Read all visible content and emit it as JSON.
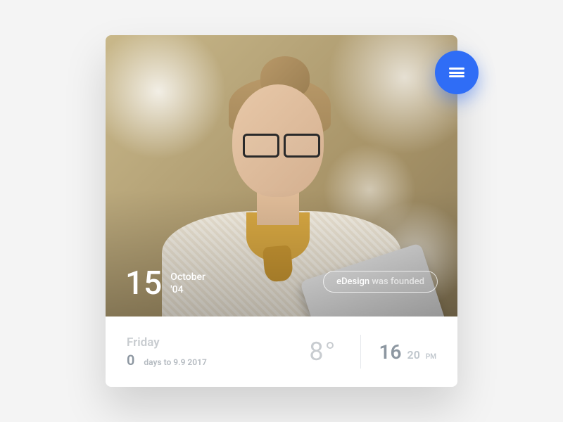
{
  "date": {
    "day": "15",
    "month": "October",
    "year": "'04"
  },
  "badge": {
    "brand": "eDesign",
    "rest": " was founded"
  },
  "footer": {
    "weekday": "Friday",
    "countdown_number": "0",
    "countdown_label": "days to 9.9 2017",
    "temperature": "8",
    "hour": "16",
    "minute": "20",
    "period": "PM"
  },
  "colors": {
    "accent": "#2f6df6"
  }
}
